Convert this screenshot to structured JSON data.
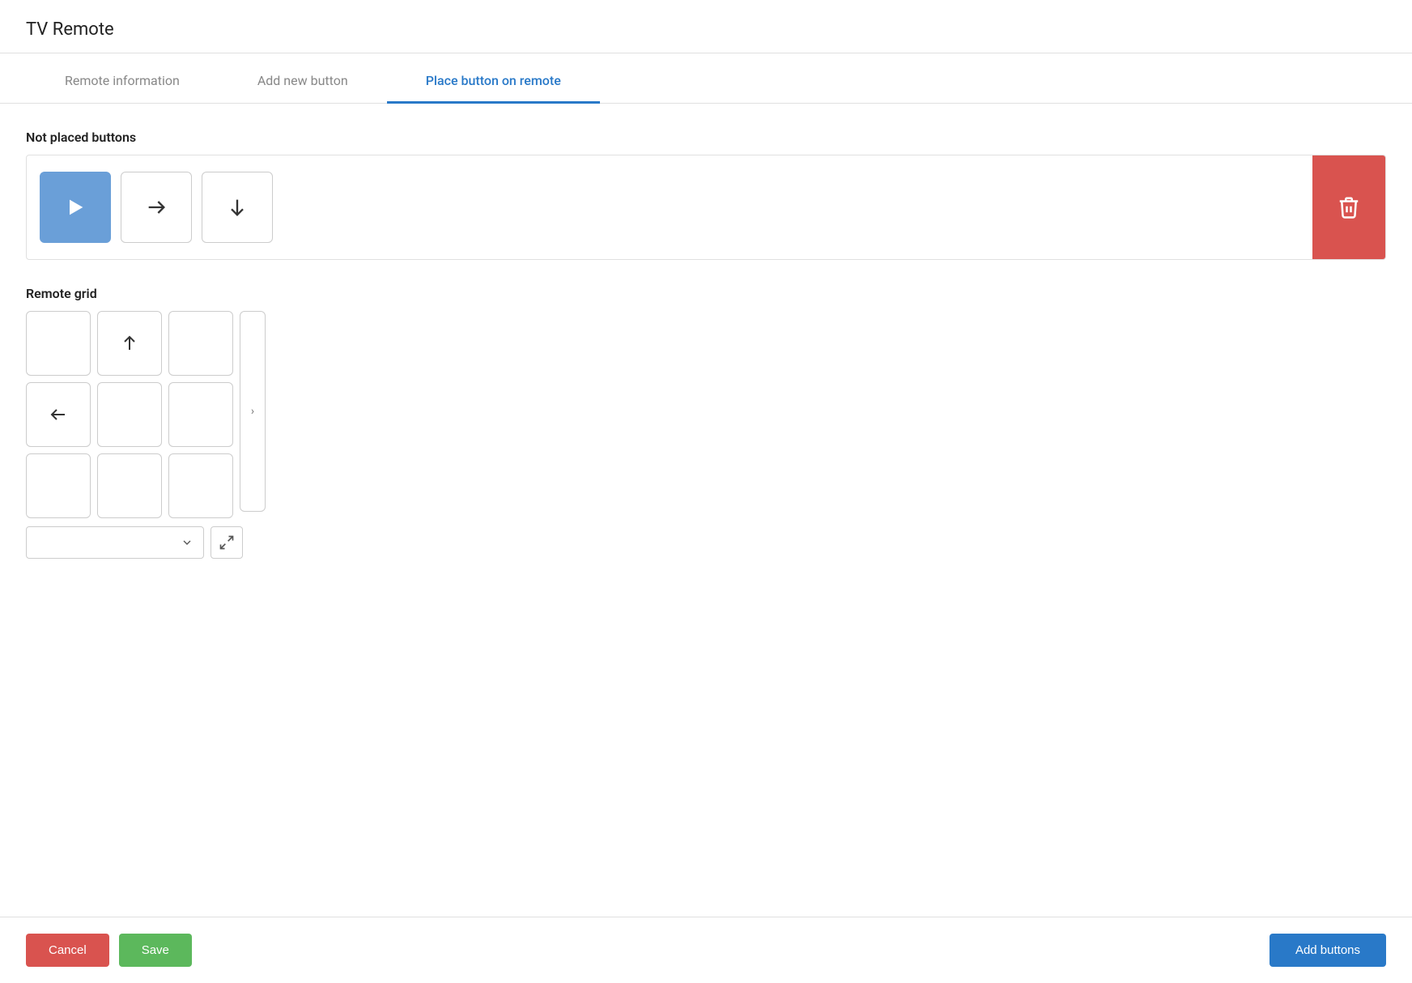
{
  "page": {
    "title": "TV Remote"
  },
  "tabs": [
    {
      "id": "remote-info",
      "label": "Remote information",
      "active": false
    },
    {
      "id": "add-button",
      "label": "Add new button",
      "active": false
    },
    {
      "id": "place-button",
      "label": "Place button on remote",
      "active": true
    }
  ],
  "not_placed_section": {
    "label": "Not placed buttons",
    "buttons": [
      {
        "id": "btn-play",
        "icon": "play",
        "selected": true
      },
      {
        "id": "btn-arrow-right",
        "icon": "arrow-right",
        "selected": false
      },
      {
        "id": "btn-arrow-down",
        "icon": "arrow-down",
        "selected": false
      }
    ],
    "delete_zone_label": "Delete"
  },
  "remote_grid_section": {
    "label": "Remote grid",
    "cells": [
      {
        "row": 0,
        "col": 0,
        "icon": null
      },
      {
        "row": 0,
        "col": 1,
        "icon": "arrow-up"
      },
      {
        "row": 0,
        "col": 2,
        "icon": null
      },
      {
        "row": 1,
        "col": 0,
        "icon": "arrow-left"
      },
      {
        "row": 1,
        "col": 1,
        "icon": null
      },
      {
        "row": 1,
        "col": 2,
        "icon": null
      },
      {
        "row": 2,
        "col": 0,
        "icon": null
      },
      {
        "row": 2,
        "col": 1,
        "icon": null
      },
      {
        "row": 2,
        "col": 2,
        "icon": null
      }
    ],
    "scroll_icon": "chevron-right",
    "dropdown_placeholder": "",
    "expand_icon": "expand"
  },
  "footer": {
    "cancel_label": "Cancel",
    "save_label": "Save",
    "add_buttons_label": "Add buttons"
  }
}
